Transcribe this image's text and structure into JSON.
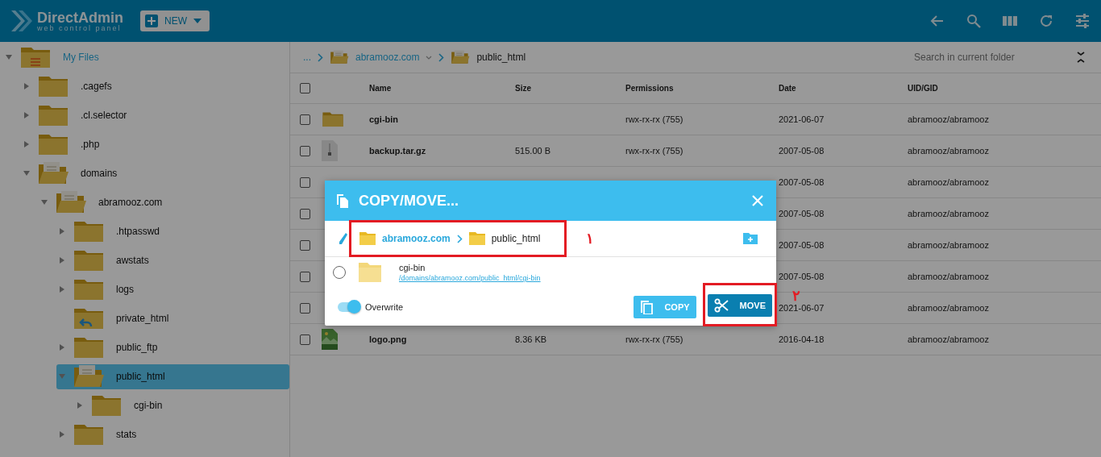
{
  "header": {
    "logo_title": "DirectAdmin",
    "logo_subtitle": "web control panel",
    "new_button": "NEW"
  },
  "sidebar": {
    "tree": [
      {
        "label": "My Files",
        "kind": "home",
        "expanded": true,
        "selected": false,
        "children": [
          {
            "label": ".cagefs",
            "kind": "folder",
            "expanded": false,
            "selected": false
          },
          {
            "label": ".cl.selector",
            "kind": "folder",
            "expanded": false,
            "selected": false
          },
          {
            "label": ".php",
            "kind": "folder",
            "expanded": false,
            "selected": false
          },
          {
            "label": "domains",
            "kind": "folder",
            "expanded": true,
            "selected": false,
            "children": [
              {
                "label": "abramooz.com",
                "kind": "folder",
                "expanded": true,
                "selected": false,
                "children": [
                  {
                    "label": ".htpasswd",
                    "kind": "folder",
                    "expanded": false,
                    "selected": false
                  },
                  {
                    "label": "awstats",
                    "kind": "folder",
                    "expanded": false,
                    "selected": false
                  },
                  {
                    "label": "logs",
                    "kind": "folder",
                    "expanded": false,
                    "selected": false
                  },
                  {
                    "label": "private_html",
                    "kind": "symlink",
                    "selected": false
                  },
                  {
                    "label": "public_ftp",
                    "kind": "folder",
                    "expanded": false,
                    "selected": false
                  },
                  {
                    "label": "public_html",
                    "kind": "folder",
                    "expanded": true,
                    "selected": true,
                    "children": [
                      {
                        "label": "cgi-bin",
                        "kind": "folder",
                        "expanded": false,
                        "selected": false
                      }
                    ]
                  },
                  {
                    "label": "stats",
                    "kind": "folder",
                    "expanded": false,
                    "selected": false
                  }
                ]
              }
            ]
          }
        ]
      }
    ]
  },
  "breadcrumb": {
    "more": "...",
    "items": [
      {
        "label": "abramooz.com",
        "current": false
      },
      {
        "label": "public_html",
        "current": true
      }
    ]
  },
  "search": {
    "placeholder": "Search in current folder"
  },
  "table": {
    "select_all_checked": false,
    "columns": [
      "Name",
      "Size",
      "Permissions",
      "Date",
      "UID/GID"
    ],
    "rows": [
      {
        "kind": "folder",
        "checked": false,
        "name": "cgi-bin",
        "permissions": "rwx-rx-rx (755)",
        "date": "2021-06-07",
        "uid": "abramooz/abramooz"
      },
      {
        "kind": "archive",
        "checked": false,
        "name": "backup.tar.gz",
        "size": "515.00 B",
        "permissions": "rwx-rx-rx (755)",
        "date": "2007-05-08",
        "uid": "abramooz/abramooz"
      },
      {
        "checked": false,
        "date": "2007-05-08",
        "uid": "abramooz/abramooz"
      },
      {
        "checked": false,
        "date": "2007-05-08",
        "uid": "abramooz/abramooz"
      },
      {
        "checked": false,
        "date": "2007-05-08",
        "uid": "abramooz/abramooz"
      },
      {
        "checked": false,
        "date": "2007-05-08",
        "uid": "abramooz/abramooz"
      },
      {
        "checked": false,
        "date": "2021-06-07",
        "uid": "abramooz/abramooz"
      },
      {
        "kind": "image",
        "checked": false,
        "name": "logo.png",
        "size": "8.36 KB",
        "permissions": "rwx-rx-rx (755)",
        "date": "2016-04-18",
        "uid": "abramooz/abramooz"
      }
    ]
  },
  "dialog": {
    "title": "COPY/MOVE...",
    "path": [
      {
        "label": "abramooz.com",
        "current": false
      },
      {
        "label": "public_html",
        "current": true
      }
    ],
    "path_marker": "١",
    "folders": [
      {
        "name": "cgi-bin",
        "path": "/domains/abramooz.com/public_html/cgi-bin",
        "selected": false
      }
    ],
    "overwrite": {
      "label": "Overwrite",
      "on": true
    },
    "buttons": [
      {
        "kind": "copy",
        "label": "COPY",
        "highlighted": false
      },
      {
        "kind": "move",
        "label": "MOVE",
        "highlighted": true
      }
    ],
    "button_marker": "٢"
  }
}
